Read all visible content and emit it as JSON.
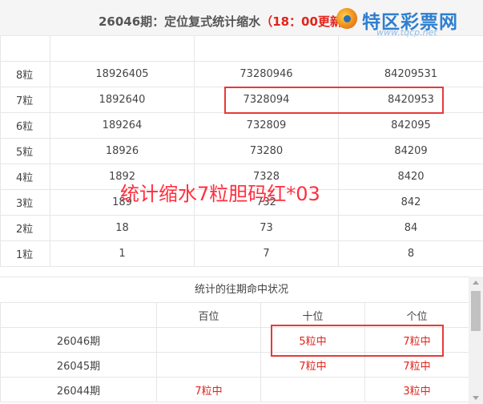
{
  "header": {
    "title": "26046期：定位复式统计缩水",
    "update": "（18：00更新）",
    "logo_text": "特区彩票网",
    "logo_url": "www.tqcp.net"
  },
  "grid": {
    "rows": [
      {
        "label": "8粒",
        "a": "18926405",
        "b": "73280946",
        "c": "84209531"
      },
      {
        "label": "7粒",
        "a": "1892640",
        "b": "7328094",
        "c": "8420953"
      },
      {
        "label": "6粒",
        "a": "189264",
        "b": "732809",
        "c": "842095"
      },
      {
        "label": "5粒",
        "a": "18926",
        "b": "73280",
        "c": "84209"
      },
      {
        "label": "4粒",
        "a": "1892",
        "b": "7328",
        "c": "8420"
      },
      {
        "label": "3粒",
        "a": "189",
        "b": "732",
        "c": "842"
      },
      {
        "label": "2粒",
        "a": "18",
        "b": "73",
        "c": "84"
      },
      {
        "label": "1粒",
        "a": "1",
        "b": "7",
        "c": "8"
      }
    ]
  },
  "overlay": {
    "text": "统计缩水7粒胆码红*03"
  },
  "history": {
    "title": "统计的往期命中状况",
    "columns": [
      "",
      "百位",
      "十位",
      "个位"
    ],
    "rows": [
      {
        "period": "26046期",
        "bai": "",
        "shi": "5粒中",
        "ge": "7粒中"
      },
      {
        "period": "26045期",
        "bai": "",
        "shi": "7粒中",
        "ge": "7粒中"
      },
      {
        "period": "26044期",
        "bai": "7粒中",
        "shi": "",
        "ge": "3粒中"
      }
    ]
  },
  "colors": {
    "accent_red": "#e3231b",
    "logo_blue": "#2d7fcf"
  }
}
